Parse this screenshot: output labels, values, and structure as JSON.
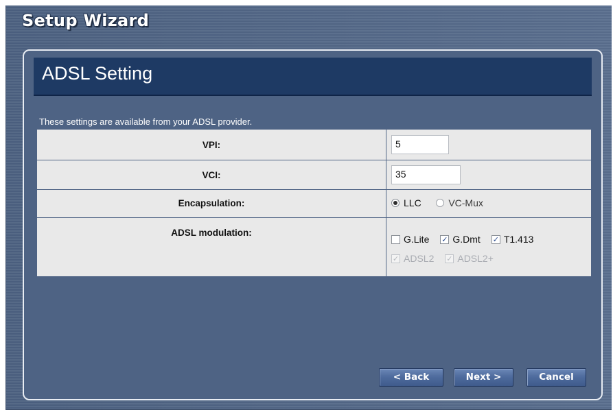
{
  "wizard": {
    "title": "Setup Wizard"
  },
  "page": {
    "heading": "ADSL Setting",
    "intro": "These settings are available from your ADSL provider."
  },
  "fields": {
    "vpi": {
      "label": "VPI:",
      "value": "5"
    },
    "vci": {
      "label": "VCI:",
      "value": "35"
    },
    "encapsulation": {
      "label": "Encapsulation:",
      "options": [
        {
          "label": "LLC",
          "selected": true
        },
        {
          "label": "VC-Mux",
          "selected": false
        }
      ]
    },
    "modulation": {
      "label": "ADSL modulation:",
      "options": [
        {
          "label": "G.Lite",
          "checked": false,
          "disabled": false
        },
        {
          "label": "G.Dmt",
          "checked": true,
          "disabled": false
        },
        {
          "label": "T1.413",
          "checked": true,
          "disabled": false
        },
        {
          "label": "ADSL2",
          "checked": true,
          "disabled": true
        },
        {
          "label": "ADSL2+",
          "checked": true,
          "disabled": true
        }
      ]
    }
  },
  "buttons": {
    "back": "< Back",
    "next": "Next >",
    "cancel": "Cancel"
  },
  "colors": {
    "panel_background": "#4e6384",
    "header_background": "#1e3a64",
    "table_background": "#e9e9e9",
    "button": "#4f6c9e"
  }
}
